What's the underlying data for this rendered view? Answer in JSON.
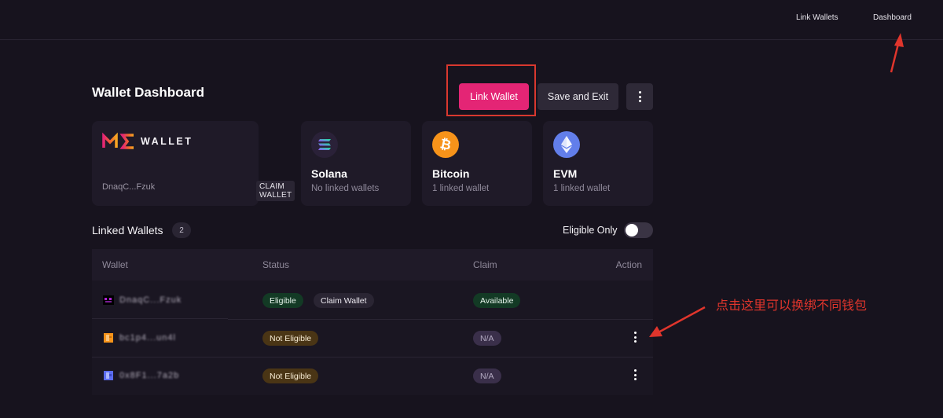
{
  "nav": {
    "links": [
      "Link Wallets",
      "Dashboard"
    ]
  },
  "header": {
    "title": "Wallet Dashboard",
    "link_wallet_label": "Link Wallet",
    "save_exit_label": "Save and Exit",
    "more_icon": "kebab-icon"
  },
  "me_card": {
    "logo_text": "WALLET",
    "address": "DnaqC...Fzuk",
    "claim_label": "CLAIM WALLET"
  },
  "chains": [
    {
      "name": "Solana",
      "status": "No linked wallets",
      "icon": "solana-icon",
      "color": "#2a2138"
    },
    {
      "name": "Bitcoin",
      "status": "1 linked wallet",
      "icon": "bitcoin-icon",
      "color": "#f7931a"
    },
    {
      "name": "EVM",
      "status": "1 linked wallet",
      "icon": "ethereum-icon",
      "color": "#627eea"
    }
  ],
  "linked": {
    "title": "Linked Wallets",
    "count": "2",
    "eligible_only_label": "Eligible Only",
    "eligible_only_on": false
  },
  "table": {
    "columns": [
      "Wallet",
      "Status",
      "Claim",
      "Action"
    ],
    "rows": [
      {
        "wallet": "DnaqC...Fzuk",
        "status": "Eligible",
        "extra": "Claim Wallet",
        "claim": "Available",
        "action": false
      },
      {
        "wallet": "bc1p4...un4l",
        "status": "Not Eligible",
        "extra": "",
        "claim": "N/A",
        "action": true
      },
      {
        "wallet": "0x8F1...7a2b",
        "status": "Not Eligible",
        "extra": "",
        "claim": "N/A",
        "action": true
      }
    ]
  },
  "annotation": {
    "text": "点击这里可以换绑不同钱包",
    "color": "#e0352c"
  },
  "colors": {
    "accent": "#e42575",
    "background": "#17131e",
    "card": "#1f1a28"
  }
}
